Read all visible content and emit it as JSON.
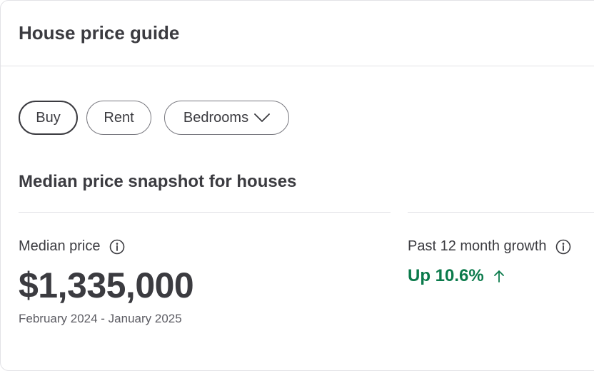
{
  "header": {
    "title": "House price guide"
  },
  "filters": {
    "buy_label": "Buy",
    "rent_label": "Rent",
    "bedrooms_label": "Bedrooms",
    "selected": "Buy"
  },
  "snapshot": {
    "title": "Median price snapshot for houses",
    "median": {
      "label": "Median price",
      "value": "$1,335,000",
      "period": "February 2024 - January 2025"
    },
    "growth": {
      "label": "Past 12 month growth",
      "value": "Up 10.6%",
      "direction": "up"
    }
  },
  "icons": {
    "info": "info-circle-icon",
    "chevron": "chevron-down-icon",
    "arrow": "arrow-up-icon"
  },
  "colors": {
    "text": "#3b3b40",
    "positive": "#0b7a4b",
    "border": "#e2e2e6"
  }
}
